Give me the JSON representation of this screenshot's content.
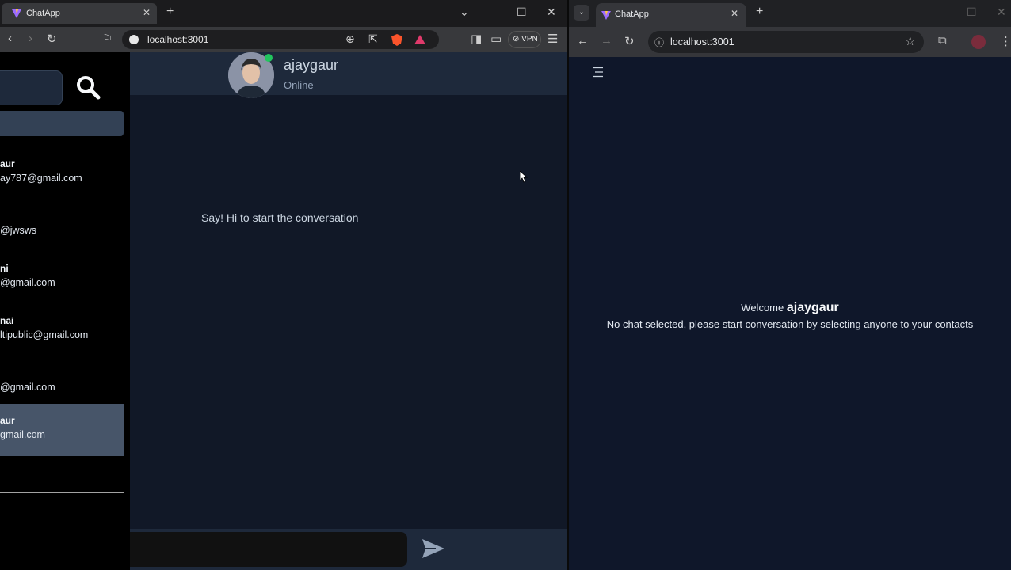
{
  "left_browser": {
    "tab_title": "ChatApp",
    "url": "localhost:3001",
    "vpn_label": "VPN"
  },
  "sidebar": {
    "contacts": [
      {
        "name": "aur",
        "email": "ay787@gmail.com",
        "selected": false
      },
      {
        "name": "",
        "email": "@jwsws",
        "selected": false
      },
      {
        "name": "ni",
        "email": "@gmail.com",
        "selected": false
      },
      {
        "name": "nai",
        "email": "ltipublic@gmail.com",
        "selected": false
      },
      {
        "name": "",
        "email": "@gmail.com",
        "selected": false
      },
      {
        "name": "aur",
        "email": "gmail.com",
        "selected": true
      }
    ]
  },
  "chat": {
    "contact_name": "ajaygaur",
    "contact_status": "Online",
    "empty_message": "Say! Hi to start the conversation"
  },
  "right_browser": {
    "tab_title": "ChatApp",
    "url": "localhost:3001",
    "welcome_prefix": "Welcome",
    "welcome_user": "ajaygaur",
    "no_chat_text": "No chat selected, please start conversation by selecting anyone to your contacts"
  },
  "colors": {
    "page_bg": "#0f172a",
    "sidebar_bg": "#000000",
    "selected_contact": "#475569",
    "online": "#22c55e"
  }
}
